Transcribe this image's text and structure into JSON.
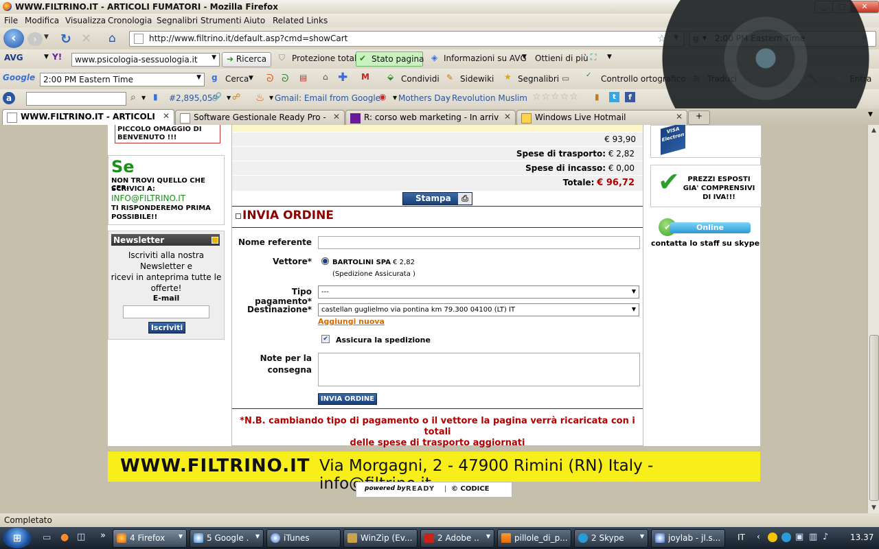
{
  "window": {
    "title": "WWW.FILTRINO.IT - ARTICOLI FUMATORI - Mozilla Firefox",
    "min": "_",
    "max": "□",
    "close": "✕"
  },
  "menu": [
    "File",
    "Modifica",
    "Visualizza",
    "Cronologia",
    "Segnalibri",
    "Strumenti",
    "Aiuto",
    "Related Links"
  ],
  "nav": {
    "url": "http://www.filtrino.it/default.asp?cmd=showCart",
    "search": "2:00 PM Eastern Time"
  },
  "avg_toolbar": {
    "logo": "AVG",
    "search_value": "www.psicologia-sessuologia.it",
    "search_btn": "Ricerca",
    "protect": "Protezione totale",
    "page_state": "Stato pagina",
    "info": "Informazioni su AVG",
    "more": "Ottieni di più"
  },
  "google_toolbar": {
    "logo": "Google",
    "value": "2:00 PM Eastern Time",
    "search": "Cerca",
    "share": "Condividi",
    "sidewiki": "Sidewiki",
    "bookmarks": "Segnalibri",
    "spell": "Controllo ortografico",
    "translate": "Traduci",
    "login": "Entra"
  },
  "misc_toolbar": {
    "counter": "#2,895,059",
    "gmail": "Gmail: Email from Google",
    "mothers": "Mothers Day",
    "revolution": "Revolution Muslim"
  },
  "tabs": [
    {
      "label": "WWW.FILTRINO.IT - ARTICOLI F..."
    },
    {
      "label": "Software Gestionale Ready Pro - For..."
    },
    {
      "label": "R: corso web marketing - In arrivo - ..."
    },
    {
      "label": "Windows Live Hotmail"
    }
  ],
  "left": {
    "omaggio": "PICCOLO OMAGGIO DI BENVENUTO !!!",
    "se_title": "Se",
    "se_line1": "NON TROVI QUELLO CHE CER-",
    "se_line2": "SCRIVICI A:",
    "se_email": "INFO@FILTRINO.IT",
    "se_line3": "TI RISPONDEREMO PRIMA",
    "se_line4": "POSSIBILE!!",
    "nl_title": "Newsletter",
    "nl_text1": "Iscriviti alla nostra",
    "nl_text2": "Newsletter e",
    "nl_text3": "ricevi in anteprima tutte le",
    "nl_text4": "offerte!",
    "nl_email_label": "E-mail",
    "nl_button": "Iscriviti"
  },
  "summary": {
    "subtotal": "€ 93,90",
    "shipping_label": "Spese di trasporto:",
    "shipping": "€ 2,82",
    "cod_label": "Spese di incasso:",
    "cod": "€ 0,00",
    "total_label": "Totale:",
    "total": "€ 96,72",
    "print": "Stampa"
  },
  "order": {
    "title": "INVIA ORDINE",
    "name_label": "Nome referente",
    "carrier_label": "Vettore*",
    "carrier_name": "BARTOLINI SPA",
    "carrier_price": "€ 2,82",
    "carrier_note": "(Spedizione Assicurata )",
    "payment_label": "Tipo pagamento*",
    "payment_value": "---",
    "dest_label": "Destinazione*",
    "dest_value": "castellan guglielmo via pontina km 79.300 04100 (LT) IT",
    "add_new": "Aggiungi nuova",
    "insure": "Assicura la spedizione",
    "notes_label1": "Note per la",
    "notes_label2": "consegna",
    "submit": "INVIA ORDINE",
    "nb1": "*N.B. cambiando tipo di pagamento o il vettore la pagina verrà ricaricata con i totali",
    "nb2": "delle spese di trasporto aggiornati"
  },
  "right": {
    "visa": "VISA Electron",
    "iva1": "PREZZI ESPOSTI",
    "iva2": "GIA' COMPRENSIVI",
    "iva3": "DI IVA!!!",
    "skype_status": "Online",
    "skype_text": "contatta lo staff su skype"
  },
  "footer": {
    "site": "WWW.FILTRINO.IT",
    "address": "Via Morgagni, 2 - 47900 Rimini (RN) Italy - info@filtrino.it",
    "powered": "powered by",
    "ready": "READY",
    "codice": "© CODICE"
  },
  "status": "Completato",
  "taskbar": {
    "items": [
      "4 Firefox",
      "5 Google ...",
      "iTunes",
      "WinZip (Ev...",
      "2 Adobe ...",
      "pillole_di_p...",
      "2 Skype",
      "joylab - jl.s..."
    ],
    "lang": "IT",
    "clock": "13.37"
  },
  "colors": {
    "accent_red": "#b00000",
    "nav_blue": "#1b3f78",
    "footer_yellow": "#f7ee1a",
    "link_orange": "#d46a00",
    "green": "#1a8f1a"
  }
}
